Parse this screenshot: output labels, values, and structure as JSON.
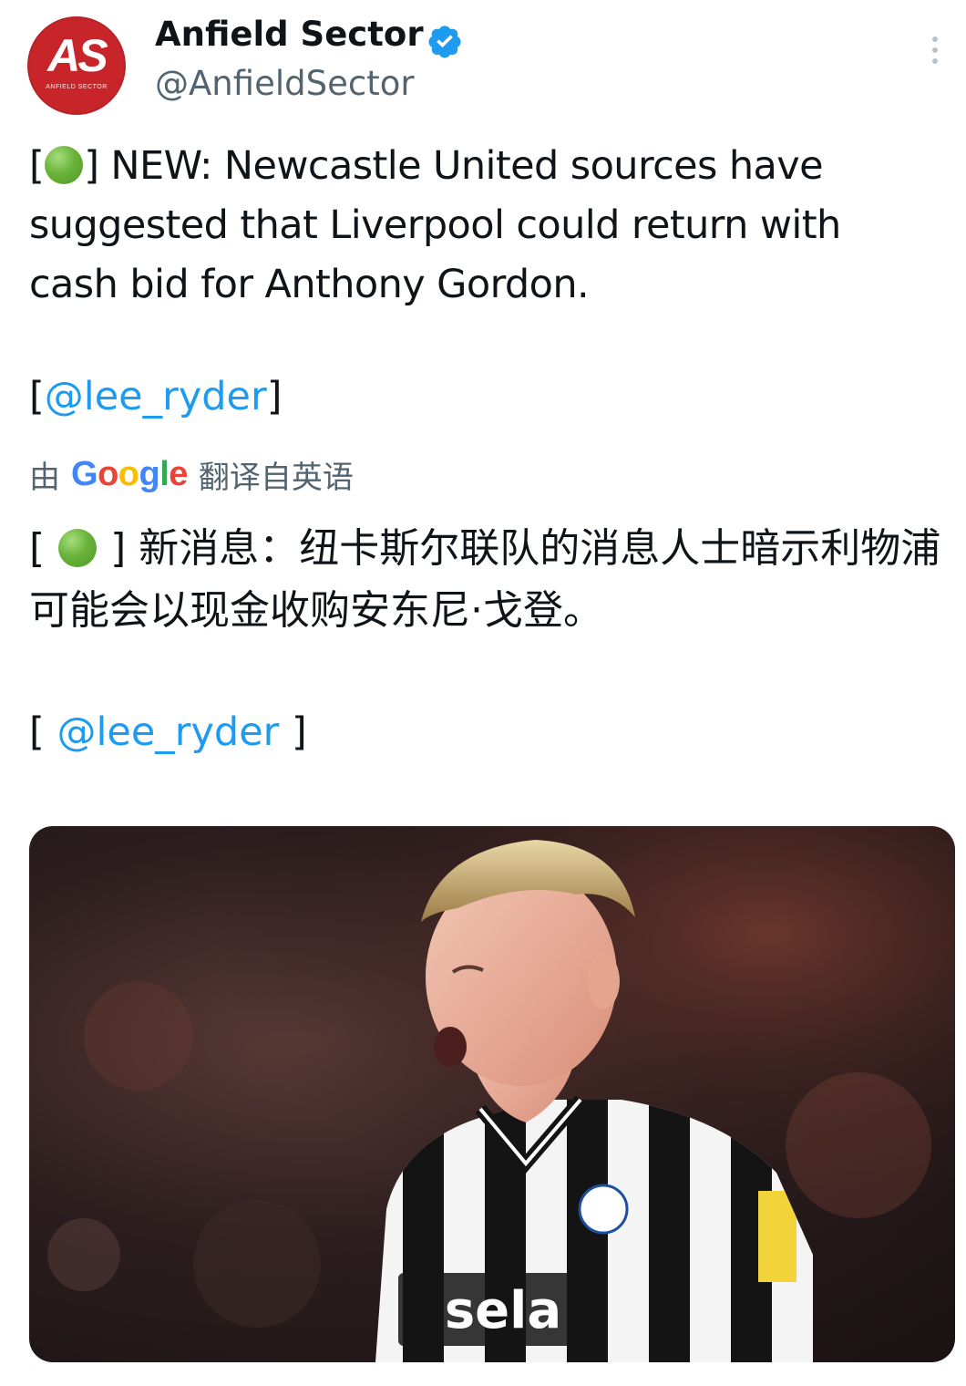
{
  "tweet": {
    "display_name": "Anfield Sector",
    "handle": "@AnfieldSector",
    "avatar": {
      "monogram": "AS",
      "sub_text": "ANFIELD SECTOR",
      "color": "#c8252b"
    },
    "verified_icon": "verified-badge-icon",
    "more_icon": "more-vertical-icon",
    "text_open": "[",
    "text_close": "] NEW: Newcastle United sources have suggested that Liverpool could return with cash bid for Anthony Gordon.",
    "mention_open": "[",
    "mention": "@lee_ryder",
    "mention_close": "]",
    "translation": {
      "prefix": "由",
      "brand": [
        "G",
        "o",
        "o",
        "g",
        "l",
        "e"
      ],
      "suffix": "翻译自英语",
      "text_open": "[ ",
      "text_close": " ] 新消息：纽卡斯尔联队的消息人士暗示利物浦可能会以现金收购安东尼·戈登。",
      "mention_open": "[ ",
      "mention": "@lee_ryder",
      "mention_close": " ]"
    },
    "media": {
      "subject": "footballer-photo",
      "shirt_sponsor": "sela"
    }
  },
  "colors": {
    "link": "#1d9bf0",
    "text": "#0f1419",
    "muted": "#536471",
    "status_dot": "#5ea832"
  }
}
